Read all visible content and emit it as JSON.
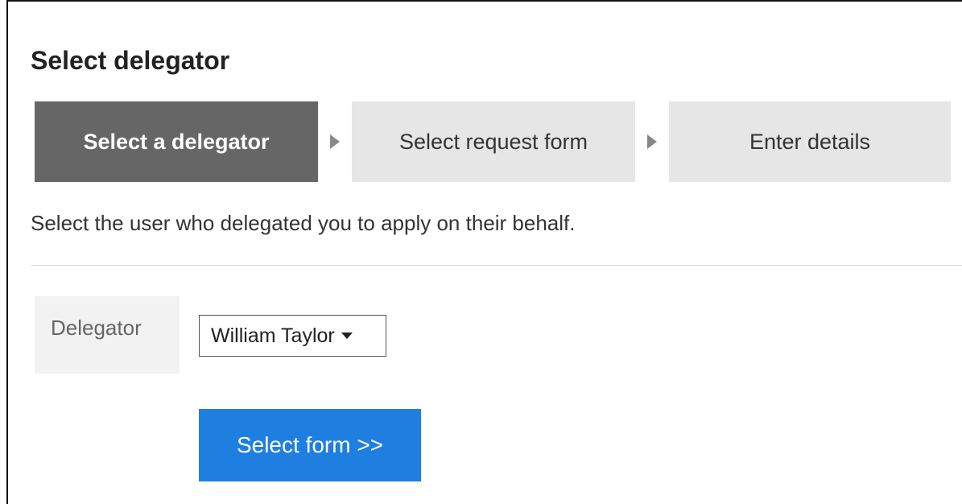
{
  "page": {
    "title": "Select delegator",
    "instructions": "Select the user who delegated you to apply on their behalf."
  },
  "steps": [
    {
      "label": "Select a delegator",
      "active": true
    },
    {
      "label": "Select request form",
      "active": false
    },
    {
      "label": "Enter details",
      "active": false
    }
  ],
  "form": {
    "delegator_label": "Delegator",
    "delegator_value": "William Taylor"
  },
  "actions": {
    "select_form_label": "Select form >>"
  },
  "colors": {
    "active_step": "#666666",
    "inactive_step": "#e6e6e6",
    "primary_button": "#1f7fe0"
  },
  "icons": {
    "step_separator": "triangle-right-icon",
    "dropdown": "caret-down-icon"
  }
}
